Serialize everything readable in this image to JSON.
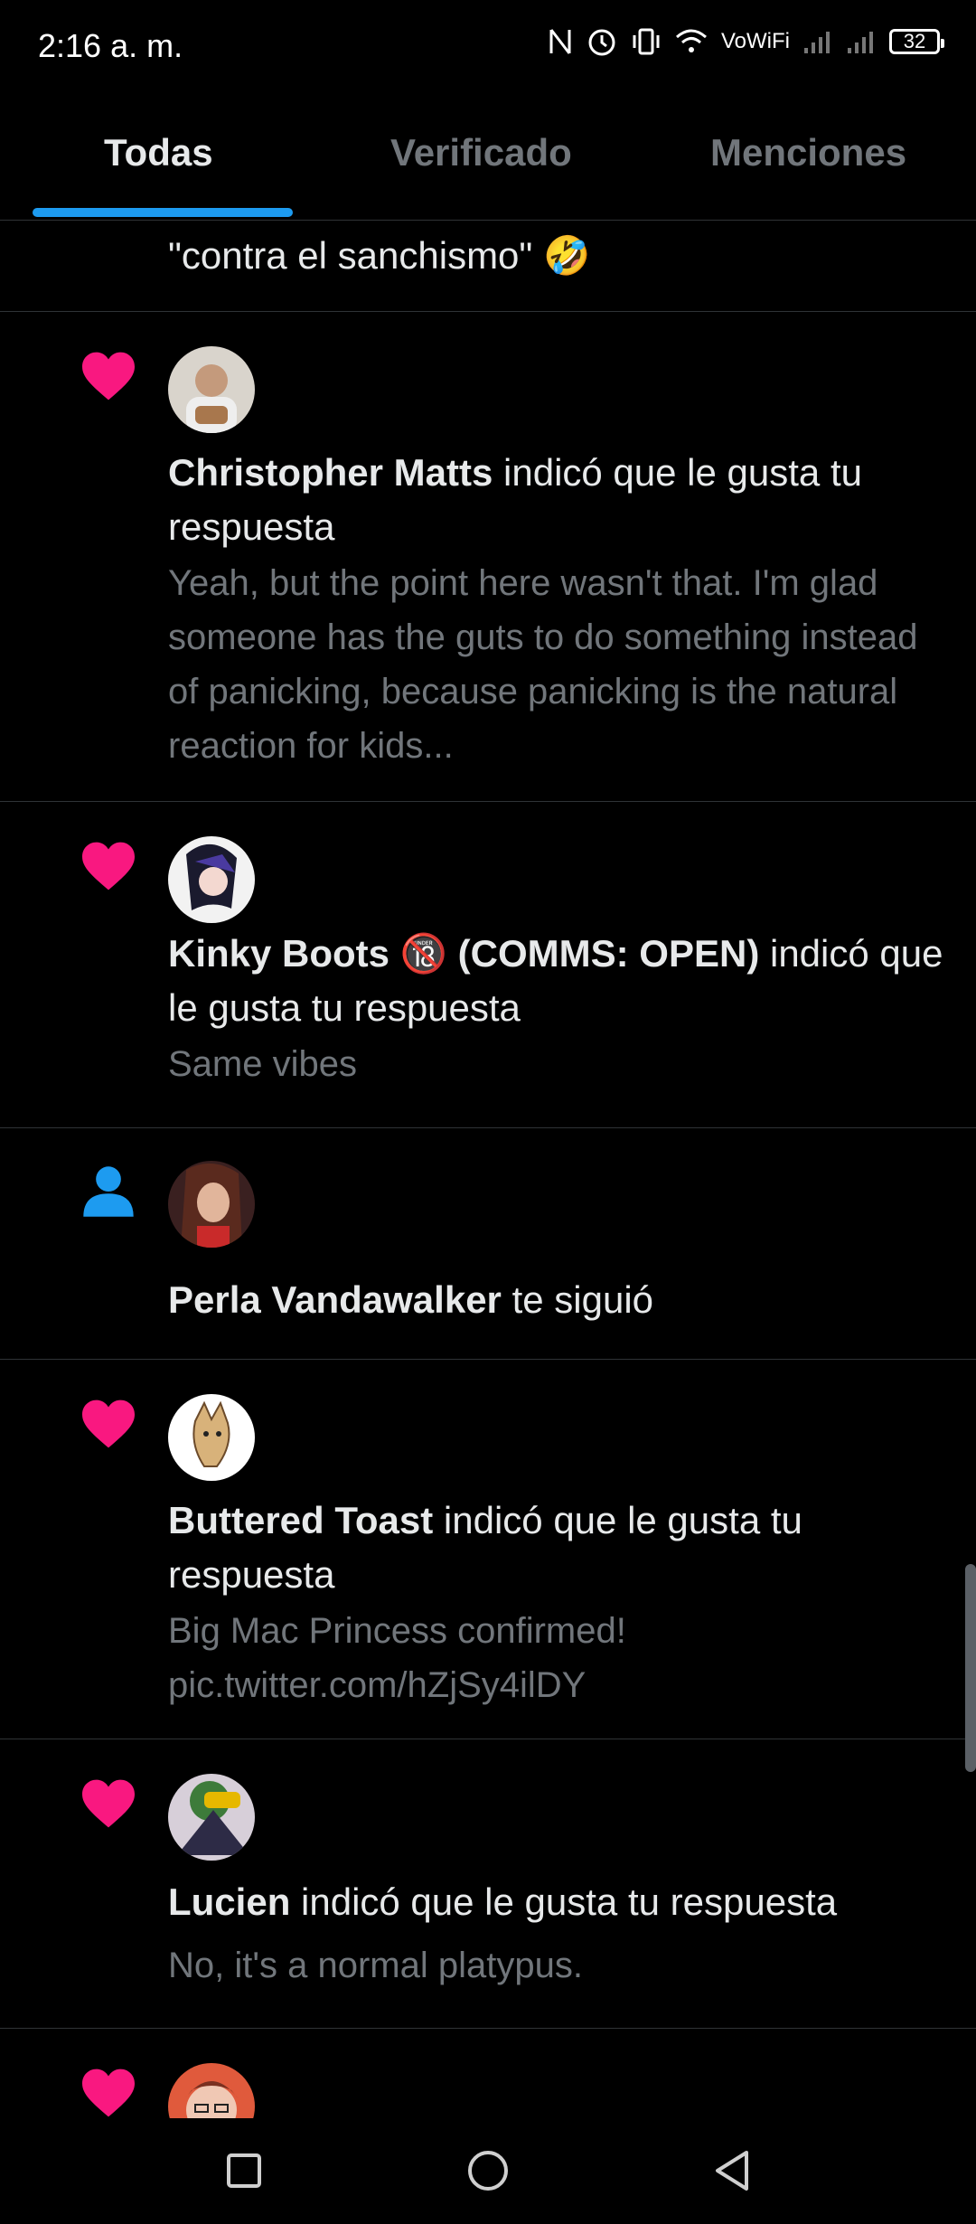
{
  "status_bar": {
    "time": "2:16 a. m.",
    "vowifi": "VoWiFi",
    "battery": "32"
  },
  "tabs": [
    {
      "label": "Todas",
      "active": true
    },
    {
      "label": "Verificado",
      "active": false
    },
    {
      "label": "Menciones",
      "active": false
    }
  ],
  "partial_top_text": "\"contra el sanchismo\" 🤣",
  "notifications": [
    {
      "type": "like",
      "name": "Christopher Matts",
      "action": " indicó que le gusta tu respuesta",
      "snippet": "Yeah, but the point here wasn't that. I'm glad someone has the guts to do something instead of panicking, because panicking is the natural reaction for kids..."
    },
    {
      "type": "like",
      "name": "Kinky Boots 🔞 (COMMS: OPEN)",
      "action": " indicó que le gusta tu respuesta",
      "snippet": "Same vibes"
    },
    {
      "type": "follow",
      "name": "Perla Vandawalker",
      "action": " te siguió",
      "snippet": ""
    },
    {
      "type": "like",
      "name": "Buttered Toast",
      "action": " indicó que le gusta tu respuesta",
      "snippet": "Big Mac Princess confirmed! pic.twitter.com/hZjSy4ilDY"
    },
    {
      "type": "like",
      "name": "Lucien",
      "action": " indicó que le gusta tu respuesta",
      "snippet": "No, it's a normal platypus."
    }
  ],
  "colors": {
    "background": "#000000",
    "like_pink": "#f91880",
    "follow_blue": "#1d9bf0",
    "accent": "#1d9bf0",
    "secondary_text": "#71767b"
  },
  "icons": {
    "like": "heart-icon",
    "follow": "person-icon"
  }
}
